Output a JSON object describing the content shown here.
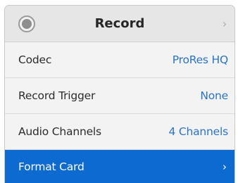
{
  "header": {
    "title": "Record",
    "icon": "record-icon",
    "chevron": "›"
  },
  "rows": [
    {
      "label": "Codec",
      "value": "ProRes HQ"
    },
    {
      "label": "Record Trigger",
      "value": "None"
    },
    {
      "label": "Audio Channels",
      "value": "4 Channels"
    },
    {
      "label": "Format Card",
      "chevron": "›",
      "selected": true
    }
  ],
  "colors": {
    "value_text": "#2a73c9",
    "selected_bg": "#0c6ad0",
    "header_bg": "#e6e6e6",
    "row_bg": "#f3f3f3"
  }
}
